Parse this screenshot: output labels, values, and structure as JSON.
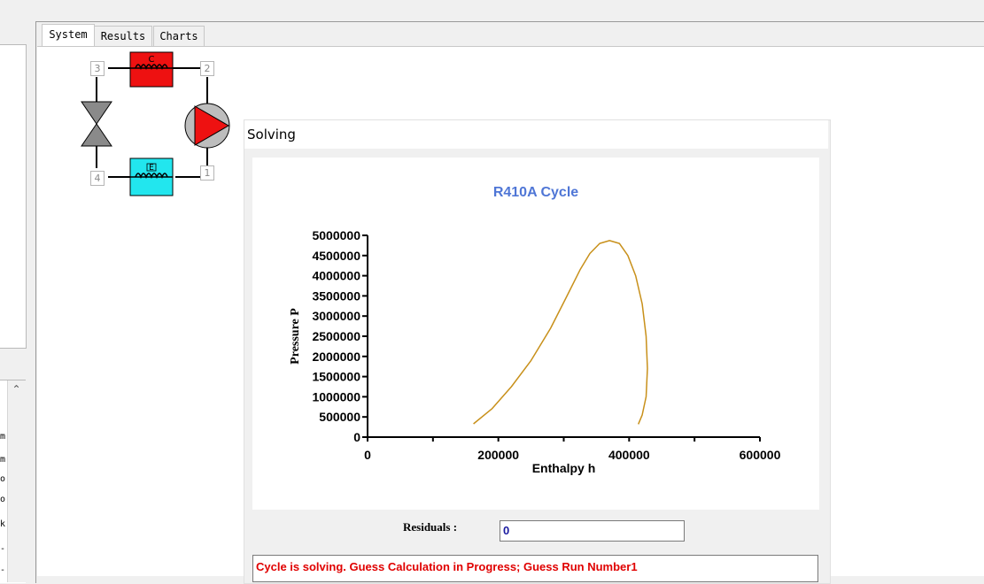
{
  "tabs": [
    {
      "label": "System"
    },
    {
      "label": "Results"
    },
    {
      "label": "Charts"
    }
  ],
  "left_list": {
    "items": [
      "m",
      "m",
      "o",
      "o",
      "k",
      "-",
      "-"
    ]
  },
  "system_diagram": {
    "nodes": [
      "1",
      "2",
      "3",
      "4"
    ],
    "condenser_label": "C",
    "evaporator_label": "E"
  },
  "dialog": {
    "title": "Solving",
    "residuals_label": "Residuals :",
    "residuals_value": "0",
    "status": "Cycle is solving. Guess Calculation in Progress; Guess Run Number1"
  },
  "chart_data": {
    "type": "line",
    "title": "R410A  Cycle",
    "xlabel": "Enthalpy h",
    "ylabel": "Pressure P",
    "xlim": [
      0,
      600000
    ],
    "ylim": [
      0,
      5000000
    ],
    "xticks": [
      "0",
      "200000",
      "400000",
      "600000"
    ],
    "yticks": [
      "0",
      "500000",
      "1000000",
      "1500000",
      "2000000",
      "2500000",
      "3000000",
      "3500000",
      "4000000",
      "4500000",
      "5000000"
    ],
    "series": [
      {
        "color": "#c8901a",
        "x": [
          162000,
          190000,
          220000,
          250000,
          280000,
          305000,
          325000,
          340000,
          355000,
          370000,
          385000,
          398000,
          410000,
          420000,
          426000,
          428000,
          426000,
          420000,
          414000
        ],
        "y": [
          330000,
          700000,
          1250000,
          1900000,
          2700000,
          3500000,
          4150000,
          4550000,
          4800000,
          4870000,
          4800000,
          4500000,
          4000000,
          3300000,
          2500000,
          1700000,
          1000000,
          550000,
          320000
        ]
      }
    ],
    "title_color": "#4f76d6"
  }
}
